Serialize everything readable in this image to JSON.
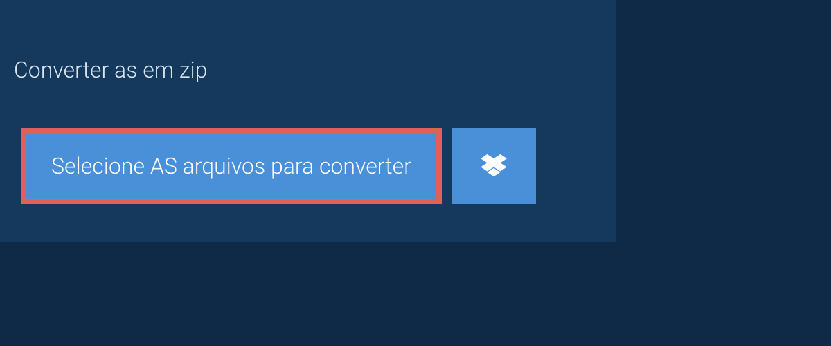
{
  "tab": {
    "label": "Converter as em zip"
  },
  "buttons": {
    "select_files_label": "Selecione AS arquivos para converter"
  },
  "colors": {
    "background_outer": "#0e2a47",
    "background_inner": "#14395d",
    "button_bg": "#4a90d9",
    "highlight_border": "#e06257",
    "text_light": "#ffffff"
  }
}
